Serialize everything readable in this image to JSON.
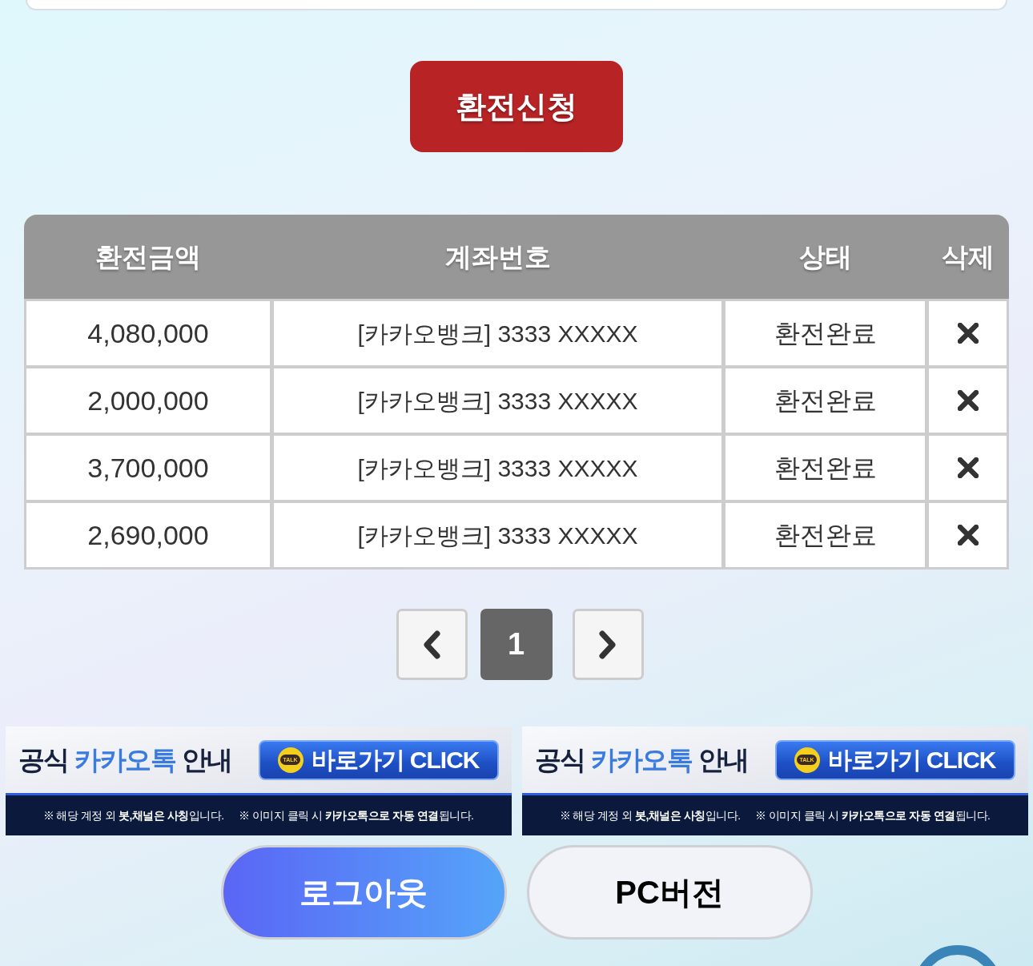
{
  "exchange_button": {
    "label": "환전신청"
  },
  "table": {
    "columns": [
      "환전금액",
      "계좌번호",
      "상태",
      "삭제"
    ],
    "rows": [
      {
        "amount": "4,080,000",
        "account": "[카카오뱅크] 3333 XXXXX",
        "status": "환전완료"
      },
      {
        "amount": "2,000,000",
        "account": "[카카오뱅크] 3333 XXXXX",
        "status": "환전완료"
      },
      {
        "amount": "3,700,000",
        "account": "[카카오뱅크] 3333 XXXXX",
        "status": "환전완료"
      },
      {
        "amount": "2,690,000",
        "account": "[카카오뱅크] 3333 XXXXX",
        "status": "환전완료"
      }
    ]
  },
  "pagination": {
    "pages": [
      {
        "label": "1",
        "selected": true
      }
    ]
  },
  "banners": [
    {
      "title": [
        {
          "text": "공식 ",
          "kind": "plain"
        },
        {
          "text": "카카오톡",
          "kind": "highlight"
        },
        {
          "text": " 안내",
          "kind": "plain"
        }
      ],
      "badge": "TALK",
      "cta": "바로가기 CLICK",
      "notes": [
        "※ 해당 계정 외 **봇,채널은 사칭**입니다.",
        "※ 이미지 클릭 시 **카카오톡으로 자동 연결**됩니다."
      ]
    },
    {
      "title": [
        {
          "text": "공식 ",
          "kind": "plain"
        },
        {
          "text": "카카오톡",
          "kind": "highlight"
        },
        {
          "text": " 안내",
          "kind": "plain"
        }
      ],
      "badge": "TALK",
      "cta": "바로가기 CLICK",
      "notes": [
        "※ 해당 계정 외 **봇,채널은 사칭**입니다.",
        "※ 이미지 클릭 시 **카카오톡으로 자동 연결**됩니다."
      ]
    }
  ],
  "buttons": [
    {
      "label": "로그아웃",
      "kind": "primary"
    },
    {
      "label": "PC버전",
      "kind": "secondary"
    }
  ]
}
